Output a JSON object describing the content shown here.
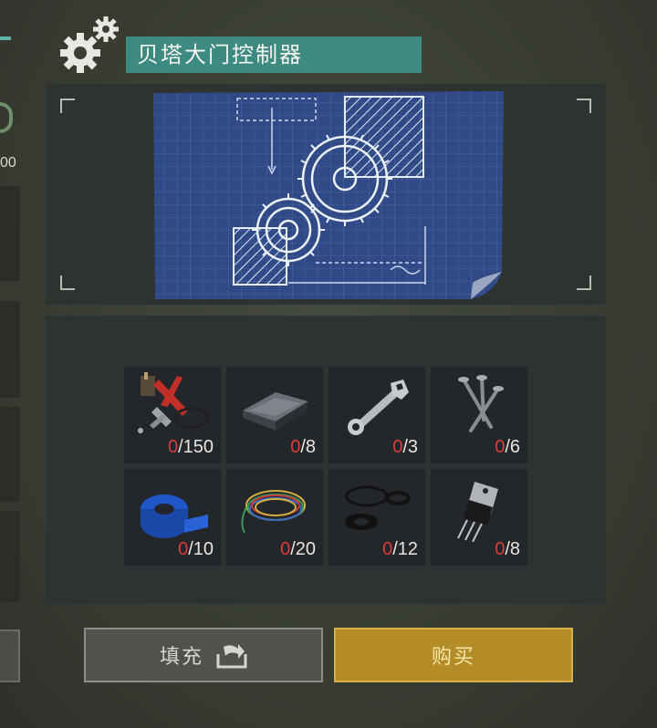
{
  "header": {
    "title": "贝塔大门控制器",
    "icon": "gears-icon"
  },
  "left_column": {
    "partial_count": "00"
  },
  "blueprint": {
    "icon": "blueprint-gears-icon"
  },
  "materials": [
    {
      "name": "pliers-and-parts",
      "icon": "pliers-icon",
      "have": "0",
      "need": "/150"
    },
    {
      "name": "metal-ingot",
      "icon": "ingot-icon",
      "have": "0",
      "need": "/8"
    },
    {
      "name": "wrench",
      "icon": "wrench-icon",
      "have": "0",
      "need": "/3"
    },
    {
      "name": "nails",
      "icon": "nails-icon",
      "have": "0",
      "need": "/6"
    },
    {
      "name": "duct-tape",
      "icon": "tape-icon",
      "have": "0",
      "need": "/10"
    },
    {
      "name": "wire-coil",
      "icon": "wire-icon",
      "have": "0",
      "need": "/20"
    },
    {
      "name": "rubber-rings",
      "icon": "rings-icon",
      "have": "0",
      "need": "/12"
    },
    {
      "name": "transistor",
      "icon": "transistor-icon",
      "have": "0",
      "need": "/8"
    }
  ],
  "buttons": {
    "fill_label": "填充",
    "buy_label": "购买"
  },
  "colors": {
    "title_bg": "#3d8a83",
    "missing_count": "#d93d3d",
    "buy_bg": "#b58d28",
    "blueprint_bg": "#2f4a86"
  }
}
